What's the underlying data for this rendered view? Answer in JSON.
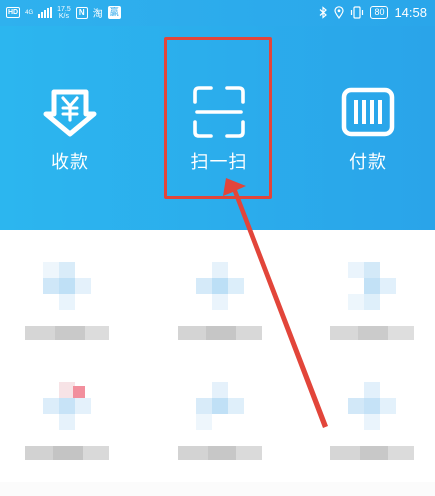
{
  "status_bar": {
    "hd": "HD",
    "network": "4G",
    "speed_value": "17.5",
    "speed_unit": "K/s",
    "nfc": "N",
    "tao": "淘",
    "ying": "赢",
    "battery": "80",
    "time": "14:58"
  },
  "actions": {
    "receive": {
      "label": "收款",
      "icon": "yen-arrow-icon"
    },
    "scan": {
      "label": "扫一扫",
      "icon": "scan-frame-icon"
    },
    "pay": {
      "label": "付款",
      "icon": "barcode-icon"
    }
  },
  "colors": {
    "header_start": "#2cb6ef",
    "header_end": "#2aa4e9",
    "annotation_red": "#e2453a"
  },
  "annotation": {
    "highlight_target": "scan",
    "arrow": "red arrow pointing to scan button"
  },
  "grid_items": [
    {
      "icon": "blurred-app-icon",
      "label_blurred": true
    },
    {
      "icon": "blurred-app-icon",
      "label_blurred": true
    },
    {
      "icon": "blurred-app-icon",
      "label_blurred": true
    },
    {
      "icon": "blurred-app-icon",
      "label_blurred": true
    },
    {
      "icon": "blurred-app-icon",
      "label_blurred": true
    },
    {
      "icon": "blurred-app-icon",
      "label_blurred": true
    }
  ]
}
